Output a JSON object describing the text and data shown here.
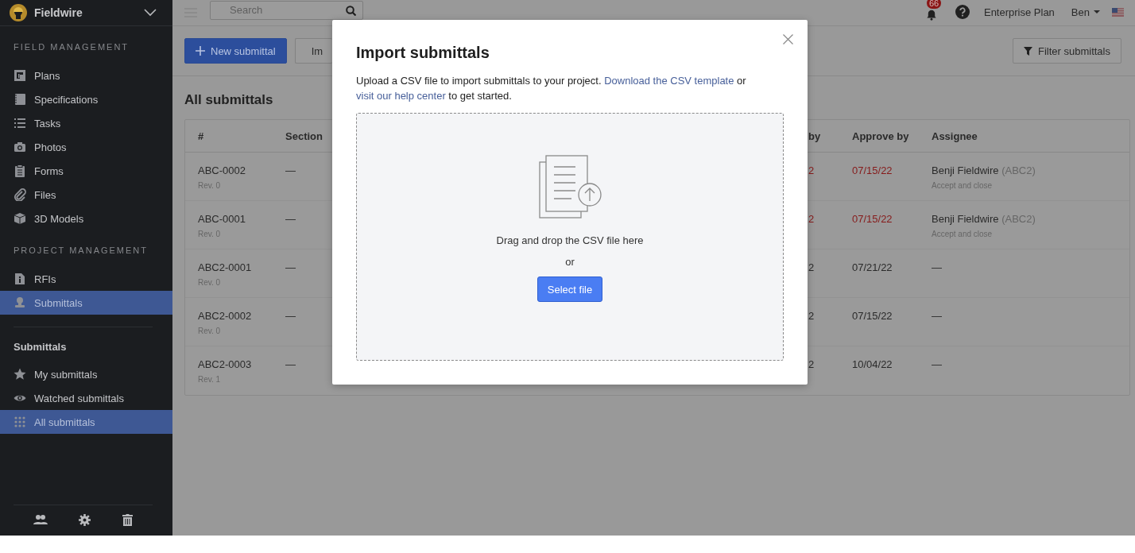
{
  "sidebar": {
    "brand": "Fieldwire",
    "sections": [
      {
        "title": "FIELD MANAGEMENT",
        "items": [
          {
            "label": "Plans",
            "selected": false
          },
          {
            "label": "Specifications",
            "selected": false
          },
          {
            "label": "Tasks",
            "selected": false
          },
          {
            "label": "Photos",
            "selected": false
          },
          {
            "label": "Forms",
            "selected": false
          },
          {
            "label": "Files",
            "selected": false
          },
          {
            "label": "3D Models",
            "selected": false
          }
        ]
      },
      {
        "title": "PROJECT MANAGEMENT",
        "items": [
          {
            "label": "RFIs",
            "selected": false
          },
          {
            "label": "Submittals",
            "selected": true
          }
        ]
      }
    ],
    "sub_nav": {
      "title": "Submittals",
      "items": [
        {
          "label": "My submittals",
          "selected": false
        },
        {
          "label": "Watched submittals",
          "selected": false
        },
        {
          "label": "All submittals",
          "selected": true
        }
      ]
    }
  },
  "topbar": {
    "search": {
      "placeholder": "Search"
    },
    "notifications_badge": "66",
    "plan": "Enterprise Plan",
    "user": "Ben"
  },
  "toolbar": {
    "new_button": "New submittal",
    "import_button": "Im",
    "filter_button": "Filter submittals"
  },
  "page_title": "All submittals",
  "table": {
    "columns": [
      "#",
      "Section",
      "by",
      "Approve by",
      "Assignee"
    ],
    "rows": [
      {
        "id": "ABC-0002",
        "revision": "Rev. 0",
        "section": "—",
        "column_3": "2",
        "approve_by": "07/15/22",
        "overdue": true,
        "assignee": "Benji Fieldwire",
        "assignee_code": "(ABC2)",
        "assignee_note": "Accept and close"
      },
      {
        "id": "ABC-0001",
        "revision": "Rev. 0",
        "section": "—",
        "column_3": "2",
        "approve_by": "07/15/22",
        "overdue": true,
        "assignee": "Benji Fieldwire",
        "assignee_code": "(ABC2)",
        "assignee_note": "Accept and close"
      },
      {
        "id": "ABC2-0001",
        "revision": "Rev. 0",
        "section": "—",
        "column_3": "2",
        "approve_by": "07/21/22",
        "overdue": false,
        "assignee": "—"
      },
      {
        "id": "ABC2-0002",
        "revision": "Rev. 0",
        "section": "—",
        "column_3": "2",
        "approve_by": "07/15/22",
        "overdue": false,
        "assignee": "—"
      },
      {
        "id": "ABC2-0003",
        "revision": "Rev. 1",
        "section": "—",
        "column_3": "2",
        "approve_by": "10/04/22",
        "overdue": false,
        "assignee": "—"
      }
    ]
  },
  "modal": {
    "title": "Import submittals",
    "description": {
      "intro": "Upload a CSV file to import submittals to your project.",
      "template_link": "Download the CSV template",
      "joiner": "or",
      "help_link": "visit our help center",
      "outro": "to get started."
    },
    "dropzone": {
      "text": "Drag and drop the CSV file here",
      "or": "or",
      "button": "Select file"
    }
  }
}
